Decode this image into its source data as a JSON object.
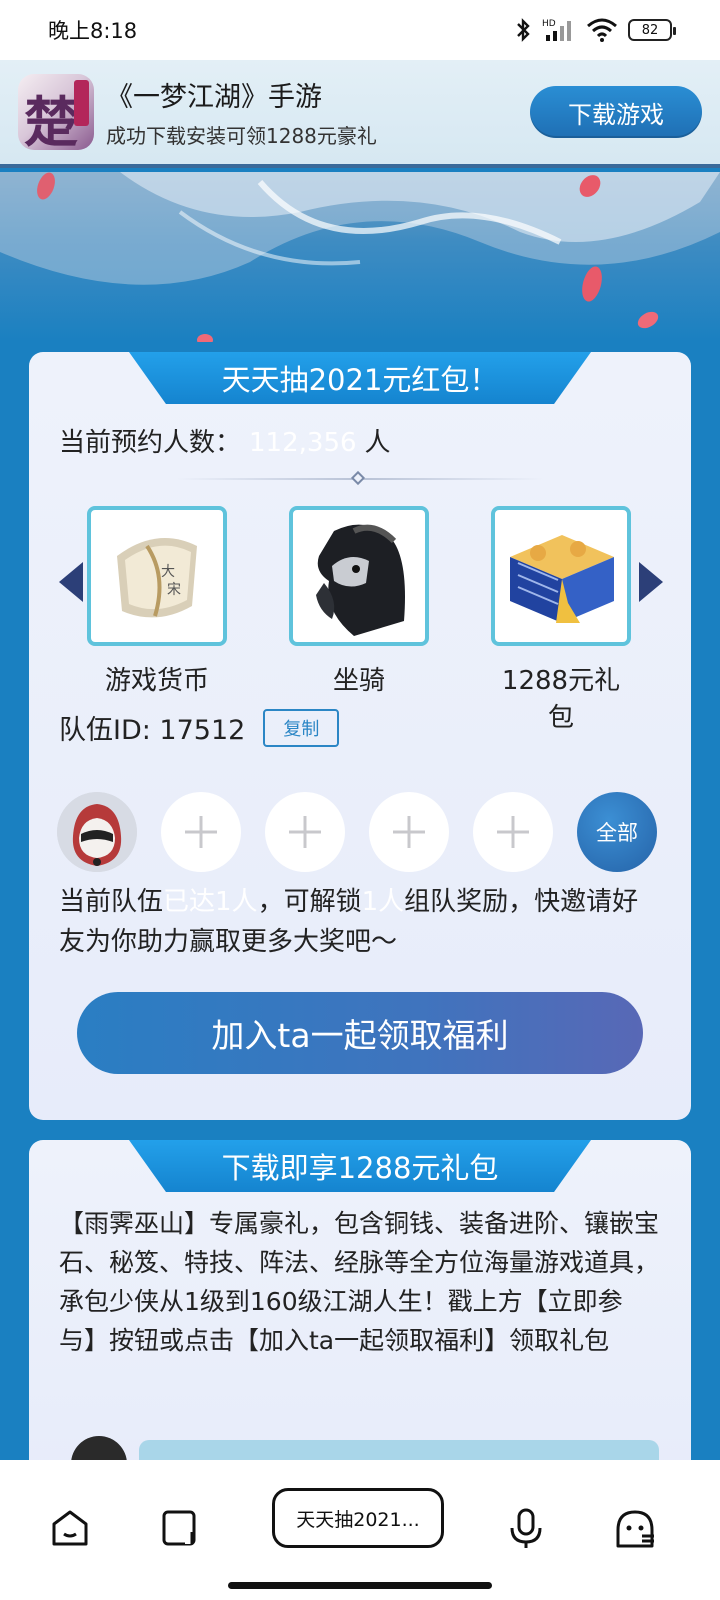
{
  "status_bar": {
    "time": "晚上8:18",
    "battery": "82"
  },
  "app_banner": {
    "title": "《一梦江湖》手游",
    "subtitle": "成功下载安装可领1288元豪礼",
    "download_label": "下载游戏"
  },
  "lottery_card": {
    "tab_title": "天天抽2021元红包！",
    "reserve_label": "当前预约人数：",
    "reserve_count": "112,356",
    "reserve_unit": "人",
    "prizes": [
      {
        "label": "游戏货币",
        "icon": "currency-scroll-icon"
      },
      {
        "label": "坐骑",
        "icon": "horse-mount-icon"
      },
      {
        "label": "1288元礼包",
        "icon": "gift-box-icon"
      }
    ],
    "team_id_label": "队伍ID: 17512",
    "copy_label": "复制",
    "all_label": "全部",
    "desc_part1": "当前队伍",
    "desc_ghost1": "已达1人",
    "desc_part2": "，可解锁",
    "desc_ghost2": "1人",
    "desc_part3": "组队奖励，快邀请好友为你助力赢取更多大奖吧～",
    "join_label": "加入ta一起领取福利"
  },
  "gift_card": {
    "tab_title": "下载即享1288元礼包",
    "description": "【雨霁巫山】专属豪礼，包含铜钱、装备进阶、镶嵌宝石、秘笈、特技、阵法、经脉等全方位海量游戏道具，承包少侠从1级到160级江湖人生！戳上方【立即参与】按钮或点击【加入ta一起领取福利】领取礼包"
  },
  "nav_bar": {
    "current_tab": "天天抽2021..."
  },
  "colors": {
    "page_bg": "#1a80c1",
    "accent": "#2a8ed4",
    "card_bg": "#eef2fb"
  }
}
